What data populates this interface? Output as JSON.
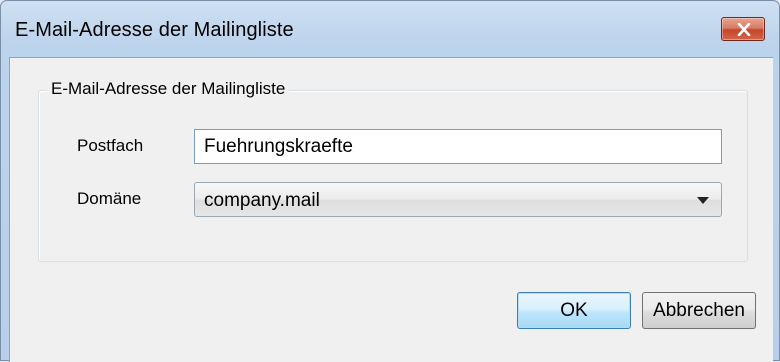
{
  "window": {
    "title": "E-Mail-Adresse der Mailingliste"
  },
  "group": {
    "legend": "E-Mail-Adresse der Mailingliste"
  },
  "fields": {
    "postfach_label": "Postfach",
    "postfach_value": "Fuehrungskraefte",
    "domaene_label": "Domäne",
    "domaene_value": "company.mail"
  },
  "buttons": {
    "ok_label": "OK",
    "cancel_label": "Abbrechen"
  },
  "colors": {
    "close_button": "#c4462b",
    "ok_border": "#3c7fb1",
    "titlebar": "#bcd3ec"
  },
  "icons": {
    "close": "close-icon",
    "dropdown": "chevron-down-icon"
  }
}
